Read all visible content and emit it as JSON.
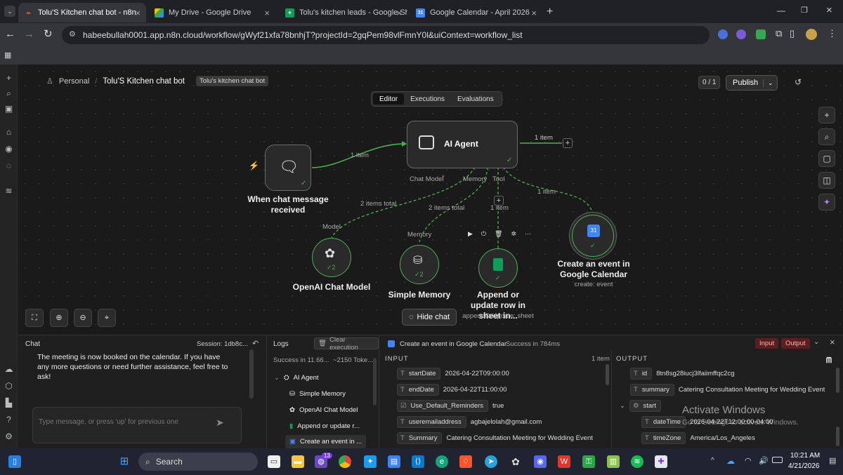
{
  "browser": {
    "tabs": [
      {
        "title": "Tolu'S Kitchen chat bot - n8n",
        "active": true,
        "icon": "n8n-icon"
      },
      {
        "title": "My Drive - Google Drive",
        "active": false,
        "icon": "drive-icon"
      },
      {
        "title": "Tolu's kitchen leads - Google Sh",
        "active": false,
        "icon": "sheets-icon"
      },
      {
        "title": "Google Calendar - April 2026",
        "active": false,
        "icon": "calendar-icon"
      }
    ],
    "url": "habeebullah0001.app.n8n.cloud/workflow/gWyf21xfa78bnhjT?projectId=2gqPem98vlFmnY0l&uiContext=workflow_list"
  },
  "header": {
    "project": "Personal",
    "workflow_name": "Tolu'S Kitchen chat bot",
    "tag": "Tolu's kitchen chat bot",
    "counter": "0 / 1",
    "publish_label": "Publish"
  },
  "tabs": [
    "Editor",
    "Executions",
    "Evaluations"
  ],
  "canvas": {
    "trigger_label": "When chat message received",
    "agent_label": "AI Agent",
    "conn_trigger_agent": "1 item",
    "conn_agent_out": "1 item",
    "port_chat_model": "Chat Model",
    "port_memory": "Memory",
    "port_tool": "Tool",
    "model_items": "2 items total",
    "memory_items": "2 items total",
    "tool_items": "1 item",
    "calendar_items": "1 item",
    "model_port": "Model",
    "memory_port": "Memory",
    "openai_label": "OpenAI Chat Model",
    "openai_badge": "2",
    "memory_label": "Simple Memory",
    "memory_badge": "2",
    "sheet_label": "Append or update row in sheet in...",
    "sheet_sub": "appendOrUpdate: sheet",
    "calendar_label": "Create an event in Google Calendar",
    "calendar_sub": "create: event",
    "hide_chat": "Hide chat"
  },
  "chat": {
    "title": "Chat",
    "session": "Session: 1db8c...",
    "message": "The meeting is now booked on the calendar. If you have any more questions or need further assistance, feel free to ask!",
    "placeholder": "Type message, or press 'up' for previous one"
  },
  "logs": {
    "title": "Logs",
    "clear": "Clear execution",
    "summary": "Success in 11.66...",
    "tokens": "~2150 Toke...",
    "items": [
      "AI Agent",
      "Simple Memory",
      "OpenAI Chat Model",
      "Append or update r...",
      "Create an event in ..."
    ]
  },
  "detail": {
    "title": "Create an event in Google Calendar",
    "status": "Success in 784ms",
    "input_btn": "Input",
    "output_btn": "Output",
    "input_label": "INPUT",
    "input_count": "1 item",
    "output_label": "OUTPUT",
    "input_rows": [
      {
        "type": "T",
        "key": "startDate",
        "value": "2026-04-22T09:00:00"
      },
      {
        "type": "T",
        "key": "endDate",
        "value": "2026-04-22T11:00:00"
      },
      {
        "type": "☑",
        "key": "Use_Default_Reminders",
        "value": "true"
      },
      {
        "type": "T",
        "key": "useremailaddress",
        "value": "agbajelolah@gmail.com"
      },
      {
        "type": "T",
        "key": "Summary",
        "value": "Catering Consultation Meeting for Wedding Event"
      }
    ],
    "output_rows": [
      {
        "type": "T",
        "key": "id",
        "value": "8tn8sg28iucj3lfaiimffqc2cg"
      },
      {
        "type": "T",
        "key": "summary",
        "value": "Catering Consultation Meeting for Wedding Event"
      },
      {
        "type": "⚙",
        "key": "start",
        "value": ""
      },
      {
        "type": "T",
        "key": "dateTime",
        "value": "2026-04-22T12:00:00-04:00"
      },
      {
        "type": "T",
        "key": "timeZone",
        "value": "America/Los_Angeles"
      }
    ]
  },
  "watermark": {
    "title": "Activate Windows",
    "sub": "Go to Settings to activate Windows."
  },
  "taskbar": {
    "search": "Search",
    "time": "10:21 AM",
    "date": "4/21/2026",
    "badge": "13"
  },
  "colors": {
    "accent": "#ff6d5a",
    "success": "#4caf50",
    "panel": "#1f1f1f"
  }
}
